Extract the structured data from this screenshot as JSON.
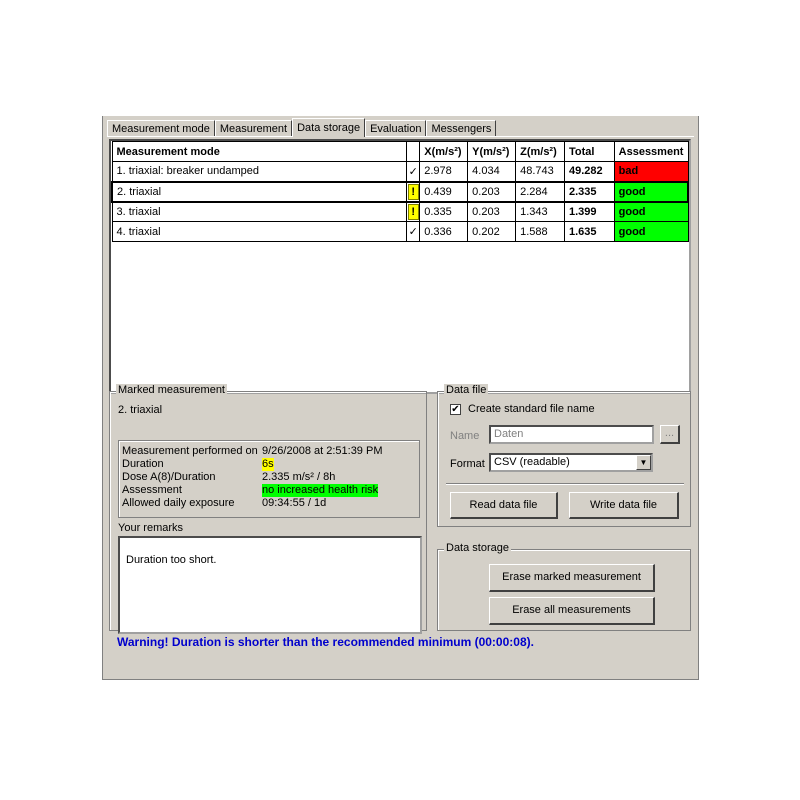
{
  "tabs": [
    {
      "label": "Measurement mode"
    },
    {
      "label": "Measurement"
    },
    {
      "label": "Data storage"
    },
    {
      "label": "Evaluation"
    },
    {
      "label": "Messengers"
    }
  ],
  "active_tab": "Data storage",
  "table": {
    "columns": [
      "Measurement mode",
      "",
      "X(m/s²)",
      "Y(m/s²)",
      "Z(m/s²)",
      "Total",
      "Assessment"
    ],
    "rows": [
      {
        "mode": "1. triaxial: breaker undamped",
        "flag": "✓",
        "x": "2.978",
        "y": "4.034",
        "z": "48.743",
        "total": "49.282",
        "assessment": "bad"
      },
      {
        "mode": "2. triaxial",
        "flag": "!",
        "x": "0.439",
        "y": "0.203",
        "z": "2.284",
        "total": "2.335",
        "assessment": "good"
      },
      {
        "mode": "3. triaxial",
        "flag": "!",
        "x": "0.335",
        "y": "0.203",
        "z": "1.343",
        "total": "1.399",
        "assessment": "good"
      },
      {
        "mode": "4. triaxial",
        "flag": "✓",
        "x": "0.336",
        "y": "0.202",
        "z": "1.588",
        "total": "1.635",
        "assessment": "good"
      }
    ]
  },
  "marked": {
    "legend": "Marked measurement",
    "name": "2. triaxial",
    "performed_label": "Measurement performed on",
    "performed_value": "9/26/2008 at 2:51:39 PM",
    "duration_label": "Duration",
    "duration_value": "6s",
    "dose_label": "Dose A(8)/Duration",
    "dose_value": "2.335 m/s² / 8h",
    "assessment_label": "Assessment",
    "assessment_value": "no increased health risk",
    "exposure_label": "Allowed daily exposure",
    "exposure_value": "09:34:55 / 1d",
    "remarks_label": "Your remarks",
    "remarks_text": "Duration too short."
  },
  "datafile": {
    "legend": "Data file",
    "create_std_label": "Create standard file name",
    "create_std_checked": "✔",
    "name_label": "Name",
    "name_value": "Daten",
    "browse_label": "...",
    "format_label": "Format",
    "format_value": "CSV (readable)",
    "read_button": "Read data file",
    "write_button": "Write data file"
  },
  "datastorage": {
    "legend": "Data storage",
    "erase_marked": "Erase marked measurement",
    "erase_all": "Erase all measurements"
  },
  "status": "Warning!  Duration is shorter than the recommended minimum (00:00:08).",
  "colors": {
    "bad": "#ff0000",
    "good": "#00ff00",
    "warning_text": "#0000cc",
    "highlight_yellow": "#ffff00"
  }
}
